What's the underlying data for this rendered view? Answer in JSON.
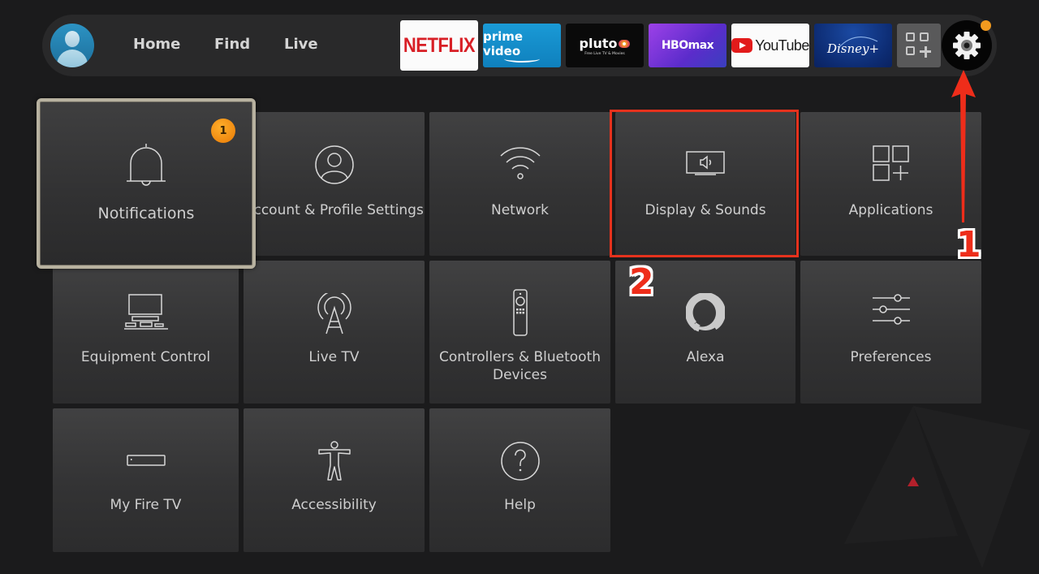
{
  "nav": {
    "avatar_label": "user-profile",
    "links": [
      {
        "label": "Home"
      },
      {
        "label": "Find"
      },
      {
        "label": "Live"
      }
    ],
    "apps": [
      {
        "name": "Netflix",
        "label": "NETFLIX",
        "color": "#d81f26"
      },
      {
        "name": "Prime Video",
        "label": "prime video",
        "color": "#1a9ad6"
      },
      {
        "name": "Pluto TV",
        "label": "pluto",
        "tagline": "Free Live TV & Movies",
        "color": "#0a0a0a"
      },
      {
        "name": "HBO Max",
        "label": "HBOmax",
        "color": "#7b36dc"
      },
      {
        "name": "YouTube",
        "label": "YouTube",
        "color": "#e21b1b"
      },
      {
        "name": "Disney+",
        "label": "Disney+",
        "color": "#0d2c73"
      }
    ],
    "apps_button_icon": "apps-grid-plus-icon",
    "settings_icon": "gear-icon",
    "settings_notification_dot_color": "#f29a1f"
  },
  "settings_tiles": [
    {
      "id": "notifications",
      "label": "Notifications",
      "icon": "bell-icon",
      "badge": "1",
      "focused": true
    },
    {
      "id": "account",
      "label": "Account & Profile Settings",
      "icon": "user-circle-icon"
    },
    {
      "id": "network",
      "label": "Network",
      "icon": "wifi-icon"
    },
    {
      "id": "display-sounds",
      "label": "Display & Sounds",
      "icon": "tv-speaker-icon",
      "highlighted": true
    },
    {
      "id": "applications",
      "label": "Applications",
      "icon": "apps-grid-plus-icon"
    },
    {
      "id": "equipment",
      "label": "Equipment Control",
      "icon": "tv-devices-icon"
    },
    {
      "id": "live-tv",
      "label": "Live TV",
      "icon": "antenna-icon"
    },
    {
      "id": "controllers",
      "label": "Controllers & Bluetooth Devices",
      "icon": "remote-icon"
    },
    {
      "id": "alexa",
      "label": "Alexa",
      "icon": "alexa-ring-icon"
    },
    {
      "id": "preferences",
      "label": "Preferences",
      "icon": "sliders-icon"
    },
    {
      "id": "my-fire-tv",
      "label": "My Fire TV",
      "icon": "fire-tv-device-icon"
    },
    {
      "id": "accessibility",
      "label": "Accessibility",
      "icon": "accessibility-person-icon"
    },
    {
      "id": "help",
      "label": "Help",
      "icon": "help-question-icon"
    }
  ],
  "annotations": {
    "step1": "1",
    "step2": "2",
    "color": "#ee2d1a"
  }
}
